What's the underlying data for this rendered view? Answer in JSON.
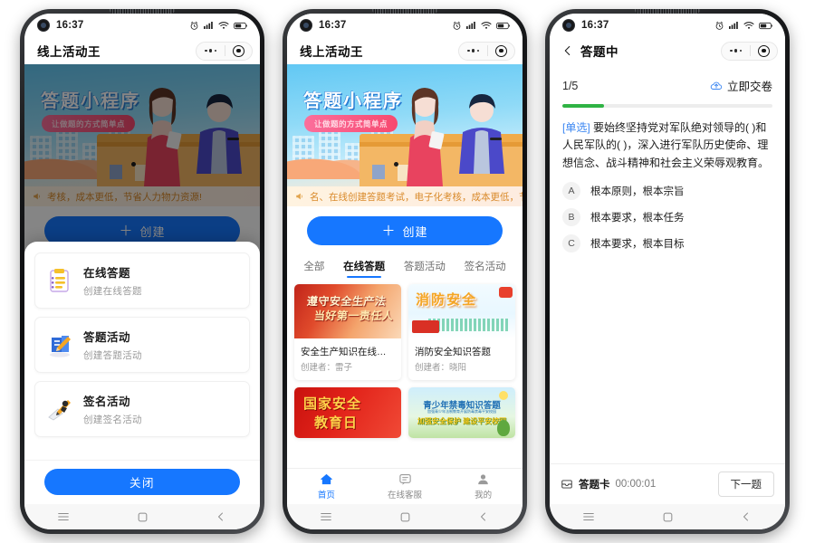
{
  "status_bar": {
    "time": "16:37",
    "icons": [
      "alarm-icon",
      "signal-icon",
      "wifi-icon",
      "battery-icon"
    ]
  },
  "phone1": {
    "nav": {
      "title": "线上活动王",
      "capsule_more": "more-dots-icon",
      "capsule_target": "target-icon"
    },
    "banner": {
      "title": "答题小程序",
      "pill": "让做题的方式简单点"
    },
    "notice": "考核，成本更低，节省人力物力资源!",
    "sheet": {
      "options": [
        {
          "icon": "clipboard-list-icon",
          "title": "在线答题",
          "subtitle": "创建在线答题"
        },
        {
          "icon": "book-quiz-icon",
          "title": "答题活动",
          "subtitle": "创建答题活动"
        },
        {
          "icon": "signature-pen-icon",
          "title": "签名活动",
          "subtitle": "创建签名活动"
        }
      ],
      "close_label": "关闭"
    }
  },
  "phone2": {
    "nav": {
      "title": "线上活动王"
    },
    "banner": {
      "title": "答题小程序",
      "pill": "让做题的方式简单点"
    },
    "notice": "名、在线创建答题考试，电子化考核，成本更低，节省人",
    "create_label": "创建",
    "tabs": [
      {
        "label": "全部",
        "active": false
      },
      {
        "label": "在线答题",
        "active": true
      },
      {
        "label": "答题活动",
        "active": false
      },
      {
        "label": "签名活动",
        "active": false
      }
    ],
    "cards": [
      {
        "thumb_text_1": "遵守安全生产法",
        "thumb_text_2": "当好第一责任人",
        "title": "安全生产知识在线答题",
        "author": "创建者：雷子",
        "style": "img-a"
      },
      {
        "thumb_text_1": "消防安全",
        "thumb_text_2": "",
        "title": "消防安全知识答题",
        "author": "创建者：晓阳",
        "style": "img-b"
      },
      {
        "thumb_text_1": "国家安全",
        "thumb_text_2": "教育日",
        "title": "",
        "author": "",
        "style": "img-c"
      },
      {
        "thumb_text_1": "青少年禁毒知识答题",
        "thumb_text_2": "加强青少年法制教育开展防毒禁毒平安校园",
        "thumb_text_3": "加强安全保护 建设平安校园",
        "title": "",
        "author": "",
        "style": "img-d"
      }
    ],
    "tabbar": [
      {
        "icon": "home-icon",
        "label": "首页",
        "active": true
      },
      {
        "icon": "chat-support-icon",
        "label": "在线客服",
        "active": false
      },
      {
        "icon": "user-profile-icon",
        "label": "我的",
        "active": false
      }
    ]
  },
  "phone3": {
    "nav": {
      "title": "答题中",
      "back": "back-chevron-icon"
    },
    "counter": "1/5",
    "submit_label": "立即交卷",
    "submit_icon": "upload-cloud-icon",
    "progress_percent": 20,
    "question_tag": "[单选]",
    "question_text": " 要始终坚持党对军队绝对领导的( )和人民军队的( )，深入进行军队历史使命、理想信念、战斗精神和社会主义荣辱观教育。",
    "options": [
      {
        "key": "A",
        "label": "根本原则，根本宗旨"
      },
      {
        "key": "B",
        "label": "根本要求，根本任务"
      },
      {
        "key": "C",
        "label": "根本要求，根本目标"
      }
    ],
    "footer": {
      "card_icon": "answer-card-icon",
      "card_label": "答题卡",
      "timer": "00:00:01",
      "next_label": "下一题"
    }
  },
  "android_nav": {
    "menu": "menu-icon",
    "home": "home-square-icon",
    "back": "back-chevron-icon"
  },
  "colors": {
    "primary": "#1677ff",
    "progress": "#2fb344",
    "notice": "#d98a2b",
    "tag": "#3a86f2"
  }
}
